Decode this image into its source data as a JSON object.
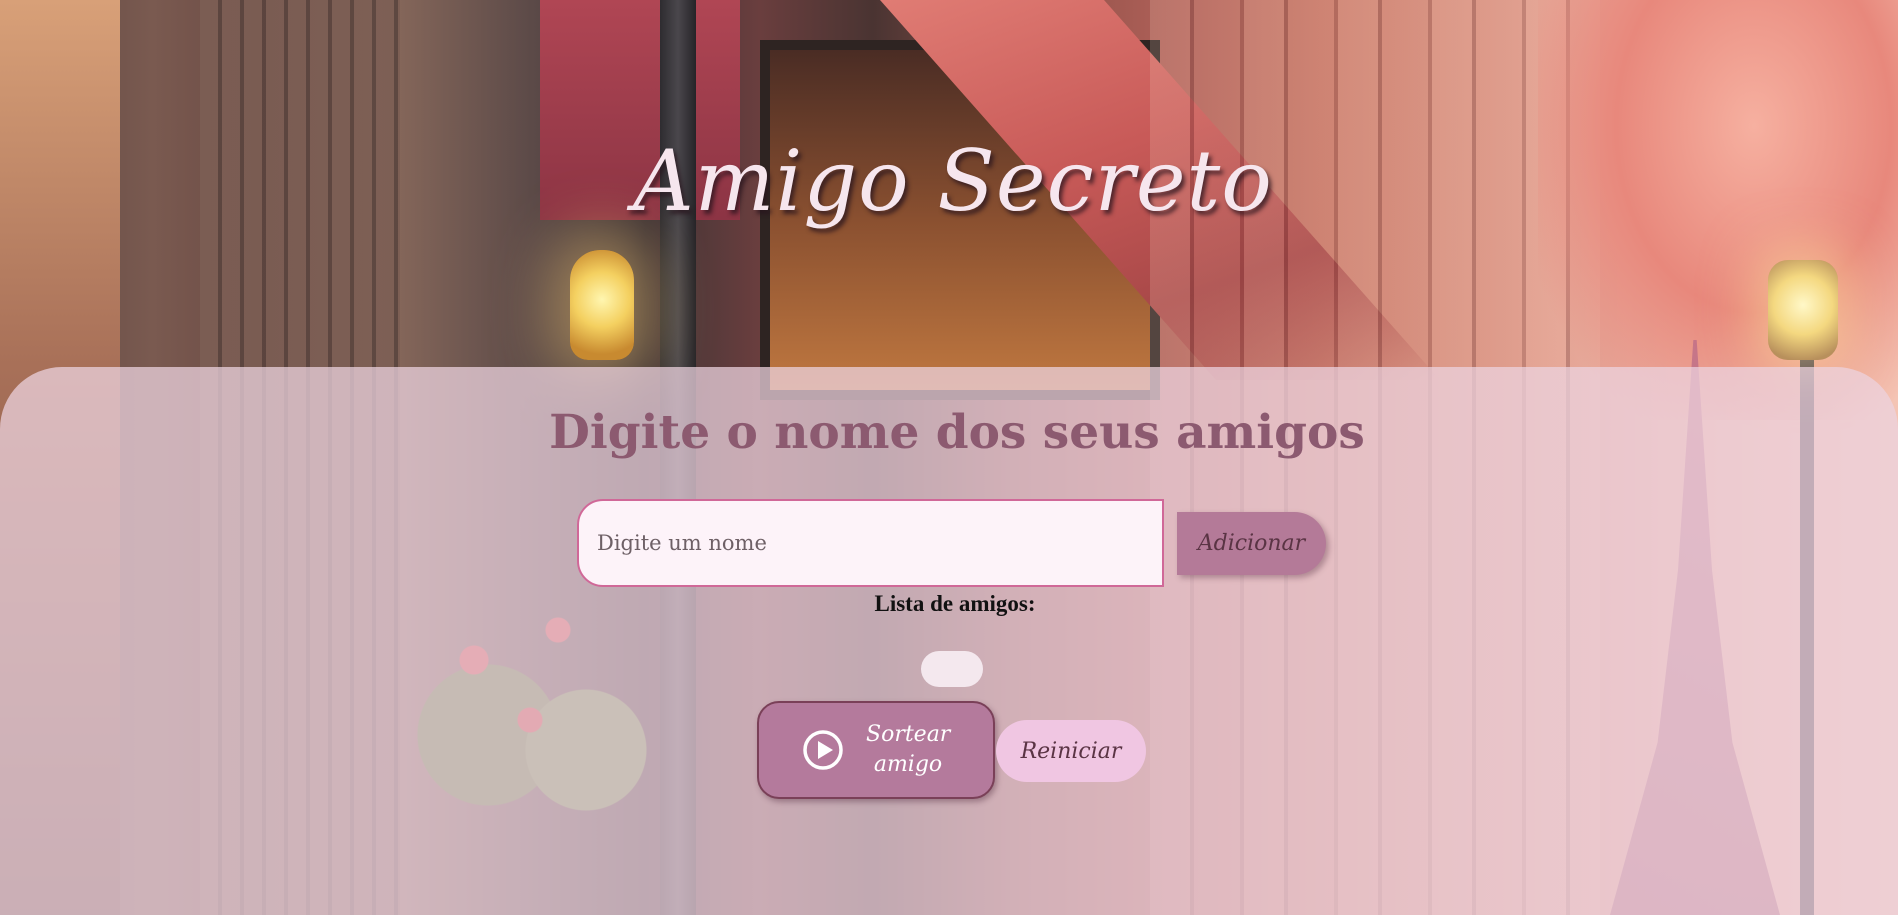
{
  "header": {
    "title": "Amigo Secreto"
  },
  "main": {
    "section_title": "Digite o nome dos seus amigos",
    "name_input": {
      "value": "",
      "placeholder": "Digite um nome"
    },
    "add_button_label": "Adicionar",
    "list_title": "Lista de amigos:",
    "friends": [],
    "draw_button_label": "Sortear amigo",
    "draw_button_icon": "play-circle-icon",
    "reset_button_label": "Reiniciar"
  },
  "colors": {
    "title_text": "#f6e6ee",
    "section_title": "#8c5a70",
    "panel_background": "#ecd2de",
    "input_border": "#d06898",
    "add_button": "#b47a98",
    "draw_button": "#b47a9c",
    "reset_button": "#f0c6e2"
  }
}
